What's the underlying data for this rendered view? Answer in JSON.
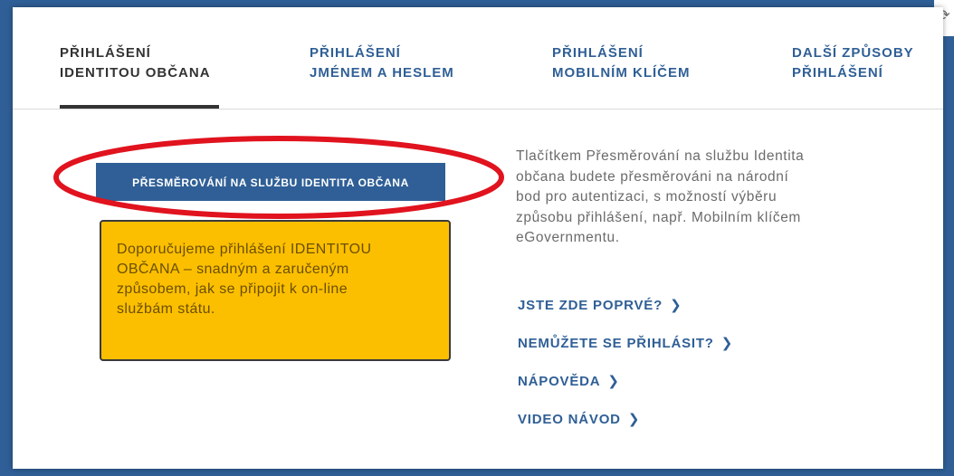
{
  "tabs": [
    {
      "label": "PŘIHLÁŠENÍ\nIDENTITOU OBČANA",
      "active": true
    },
    {
      "label": "PŘIHLÁŠENÍ\nJMÉNEM A HESLEM",
      "active": false
    },
    {
      "label": "PŘIHLÁŠENÍ\nMOBILNÍM KLÍČEM",
      "active": false
    },
    {
      "label": "DALŠÍ ZPŮSOBY\nPŘIHLÁŠENÍ",
      "active": false
    }
  ],
  "redirect_button": {
    "label": "PŘESMĚROVÁNÍ NA SLUŽBU IDENTITA OBČANA"
  },
  "recommendation_note": {
    "text": "Doporučujeme přihlášení IDENTITOU\nOBČANA – snadným a zaručeným\nzpůsobem, jak se připojit k on-line\nslužbám státu."
  },
  "description": {
    "text": "Tlačítkem Přesměrování na službu Identita\nobčana budete přesměrováni na národní\nbod pro autentizaci, s možností výběru\nzpůsobu přihlášení, např. Mobilním klíčem\neGovernmentu."
  },
  "links": [
    {
      "label": "JSTE ZDE POPRVÉ?"
    },
    {
      "label": "NEMŮŽETE SE PŘIHLÁSIT?"
    },
    {
      "label": "NÁPOVĚDA"
    },
    {
      "label": "VIDEO NÁVOD"
    }
  ],
  "icons": {
    "chevron": "chevron-right-icon"
  },
  "colors": {
    "brand_blue": "#2f5f96",
    "highlight_red": "#e0131e",
    "note_yellow": "#fcbf00"
  }
}
